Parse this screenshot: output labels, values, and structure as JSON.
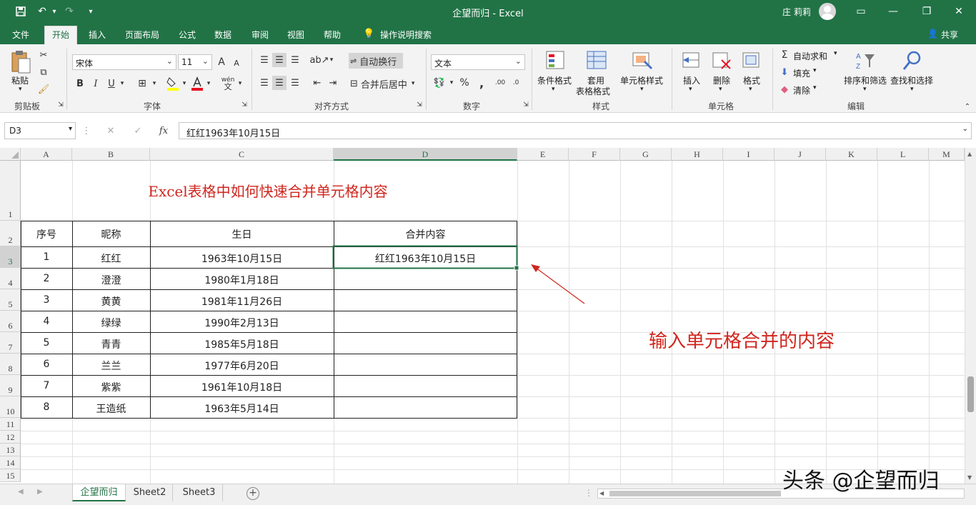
{
  "titlebar": {
    "title": "企望而归  -  Excel",
    "user": "庄 莉莉"
  },
  "menu": {
    "tabs": [
      "文件",
      "开始",
      "插入",
      "页面布局",
      "公式",
      "数据",
      "审阅",
      "视图",
      "帮助"
    ],
    "tell_me": "操作说明搜索",
    "share": "共享"
  },
  "ribbon": {
    "clipboard": {
      "paste": "粘贴",
      "label": "剪贴板"
    },
    "font": {
      "name": "宋体",
      "size": "11",
      "label": "字体",
      "bold": "B",
      "italic": "I",
      "underline": "U",
      "wen": "wén",
      "grow": "A",
      "shrink": "A"
    },
    "align": {
      "wrap": "自动换行",
      "merge": "合并后居中",
      "label": "对齐方式"
    },
    "number": {
      "format": "文本",
      "label": "数字",
      "percent": "%",
      "comma": ","
    },
    "styles": {
      "cond": "条件格式",
      "table1": "套用",
      "table2": "表格格式",
      "cell": "单元格样式",
      "label": "样式"
    },
    "cells": {
      "insert": "插入",
      "delete": "删除",
      "format": "格式",
      "label": "单元格"
    },
    "editing": {
      "autosum": "自动求和",
      "fill": "填充",
      "clear": "清除",
      "sort": "排序和筛选",
      "find": "查找和选择",
      "label": "编辑"
    }
  },
  "formula_bar": {
    "name_box": "D3",
    "fx": "fx",
    "value": "红红1963年10月15日"
  },
  "sheet": {
    "columns": [
      "A",
      "B",
      "C",
      "D",
      "E",
      "F",
      "G",
      "H",
      "I",
      "J",
      "K",
      "L",
      "M"
    ],
    "rows": [
      "1",
      "2",
      "3",
      "4",
      "5",
      "6",
      "7",
      "8",
      "9",
      "10",
      "11",
      "12",
      "13",
      "14",
      "15"
    ],
    "title": "Excel表格中如何快速合并单元格内容",
    "headers": [
      "序号",
      "昵称",
      "生日",
      "合并内容"
    ],
    "data": [
      [
        "1",
        "红红",
        "1963年10月15日",
        "红红1963年10月15日"
      ],
      [
        "2",
        "澄澄",
        "1980年1月18日",
        ""
      ],
      [
        "3",
        "黄黄",
        "1981年11月26日",
        ""
      ],
      [
        "4",
        "绿绿",
        "1990年2月13日",
        ""
      ],
      [
        "5",
        "青青",
        "1985年5月18日",
        ""
      ],
      [
        "6",
        "兰兰",
        "1977年6月20日",
        ""
      ],
      [
        "7",
        "紫紫",
        "1961年10月18日",
        ""
      ],
      [
        "8",
        "王造纸",
        "1963年5月14日",
        ""
      ]
    ],
    "annotation": "输入单元格合并的内容"
  },
  "sheet_tabs": [
    "企望而归",
    "Sheet2",
    "Sheet3"
  ],
  "watermark": "头条 @企望而归",
  "colors": {
    "accent": "#217346",
    "red": "#d0261e"
  }
}
